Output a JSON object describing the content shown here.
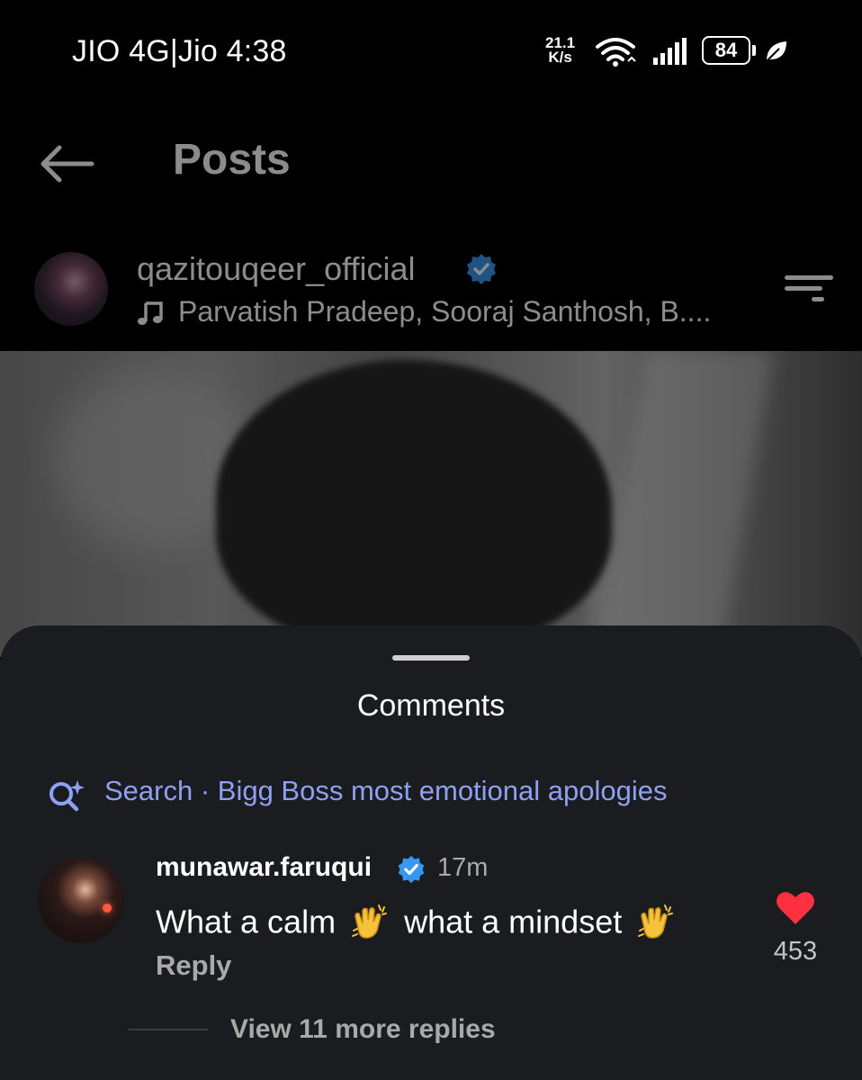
{
  "status_bar": {
    "carrier": "JIO 4G|Jio 4:38",
    "net_speed_value": "21.1",
    "net_speed_unit": "K/s",
    "battery": "84",
    "icons": [
      "wifi-icon",
      "signal-icon",
      "battery-icon",
      "leaf-icon"
    ]
  },
  "header": {
    "title": "Posts",
    "back_icon": "arrow-left-icon"
  },
  "post": {
    "username": "qazitouqeer_official",
    "verified": true,
    "music_text": "Parvatish Pradeep, Sooraj Santhosh, B....",
    "menu_icon": "menu-icon"
  },
  "comments_sheet": {
    "title": "Comments",
    "search_label": "Search · Bigg Boss most emotional apologies",
    "accent_color": "#8ea0f2",
    "comment": {
      "username": "munawar.faruqui",
      "verified": true,
      "time": "17m",
      "text_part1": "What a calm",
      "text_part2": "what a mindset",
      "reply_label": "Reply",
      "like_count": "453",
      "heart_color": "#ff3040"
    },
    "view_replies_label": "View 11 more replies"
  }
}
